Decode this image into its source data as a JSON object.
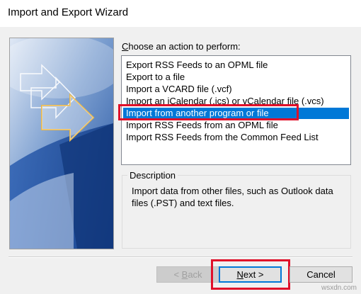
{
  "window": {
    "title": "Import and Export Wizard"
  },
  "prompt": {
    "accel": "C",
    "rest": "hoose an action to perform:"
  },
  "actions": {
    "items": [
      {
        "label": "Export RSS Feeds to an OPML file"
      },
      {
        "label": "Export to a file"
      },
      {
        "label": "Import a VCARD file (.vcf)"
      },
      {
        "label": "Import an iCalendar (.ics) or vCalendar file (.vcs)"
      },
      {
        "label": "Import from another program or file"
      },
      {
        "label": "Import RSS Feeds from an OPML file"
      },
      {
        "label": "Import RSS Feeds from the Common Feed List"
      }
    ],
    "selected_index": 4
  },
  "description": {
    "label": "Description",
    "text": "Import data from other files, such as Outlook data files (.PST) and text files."
  },
  "buttons": {
    "back_prefix": "< ",
    "back_accel": "B",
    "back_rest": "ack",
    "next_accel": "N",
    "next_rest": "ext >",
    "cancel": "Cancel"
  },
  "watermark": "wsxdn.com",
  "colors": {
    "selection": "#0078d7",
    "annotation": "#e0102a"
  }
}
